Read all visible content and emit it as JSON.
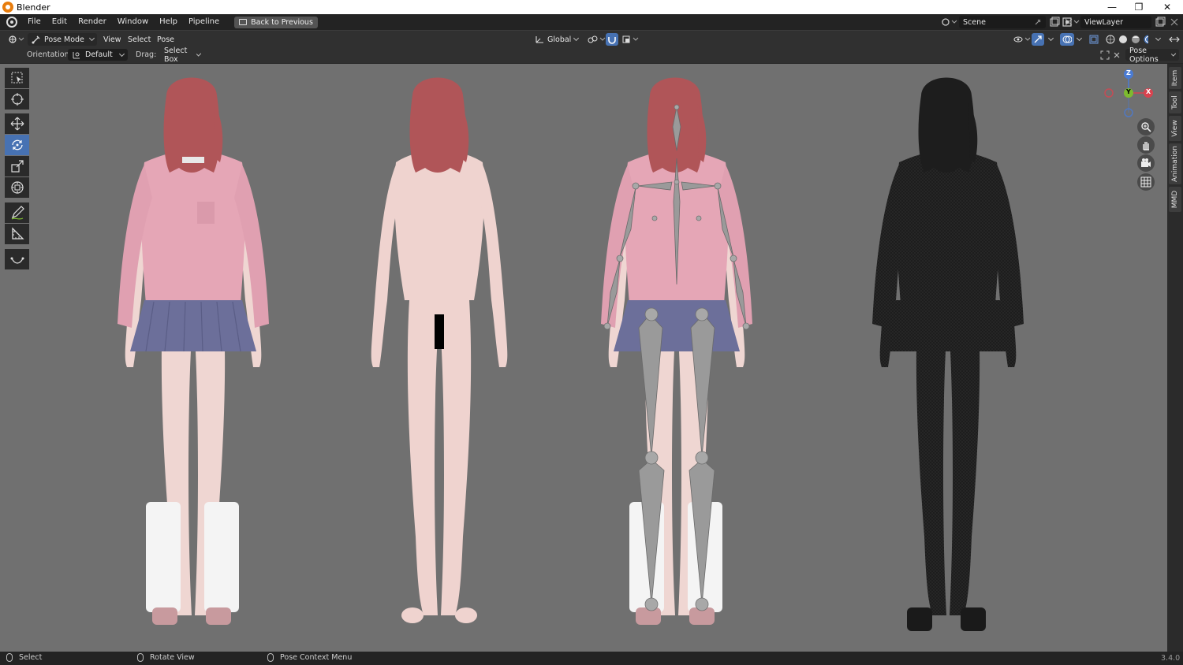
{
  "os_window": {
    "title": "Blender",
    "minimize": "—",
    "maximize": "❐",
    "close": "✕"
  },
  "topbar": {
    "menus": [
      "File",
      "Edit",
      "Render",
      "Window",
      "Help",
      "Pipeline"
    ],
    "back_button": "Back to Previous",
    "scene": "Scene",
    "view_layer": "ViewLayer"
  },
  "header": {
    "mode": "Pose Mode",
    "menus": [
      "View",
      "Select",
      "Pose"
    ],
    "transform_orientation": "Global"
  },
  "tool_settings": {
    "orientation_label": "Orientation:",
    "orientation_value": "Default",
    "drag_label": "Drag:",
    "drag_value": "Select Box",
    "pose_options": "Pose Options"
  },
  "sidebar_tabs": [
    "Item",
    "Tool",
    "View",
    "Animation",
    "MMD"
  ],
  "gizmo": {
    "z": "Z",
    "y": "Y",
    "x": "X"
  },
  "statusbar": {
    "select": "Select",
    "rotate_view": "Rotate View",
    "context_menu": "Pose Context Menu",
    "version": "3.4.0"
  },
  "colors": {
    "viewport_bg": "#707070",
    "active_blue": "#4772b3",
    "hair": "#b05558",
    "sweater": "#e7a8b8",
    "skirt": "#6c6f9a",
    "skin": "#efd6d2",
    "socks": "#f4f4f4",
    "wireframe": "#1f1f1f",
    "bone": "#9a9a9a"
  }
}
